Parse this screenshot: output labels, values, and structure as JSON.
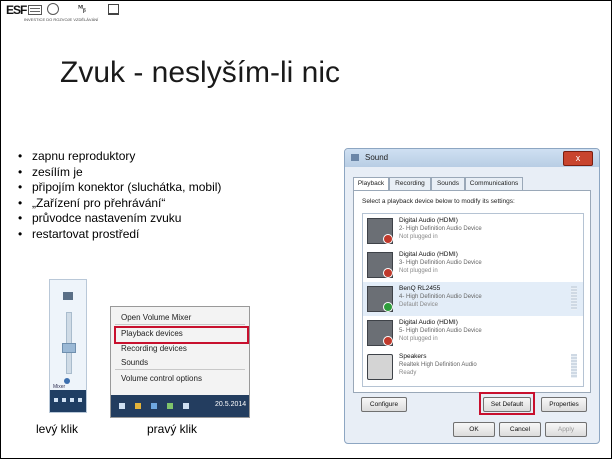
{
  "logos": {
    "esf": "ESF",
    "msmt": "ᴹᵦ",
    "tagline": "INVESTICE DO ROZVOJE VZDĚLÁVÁNÍ"
  },
  "title": "Zvuk - neslyším-li nic",
  "bullets": [
    "zapnu reproduktory",
    "zesílím je",
    "připojím konektor (sluchátka, mobil)",
    "„Zařízení pro přehrávání“",
    "průvodce nastavením zvuku",
    "restartovat prostředí"
  ],
  "left_click": {
    "caption": "levý klik",
    "mixer_label": "Mixer",
    "volume_level": 0.45
  },
  "context_menu": {
    "caption": "pravý klik",
    "items": [
      "Open Volume Mixer",
      "Playback devices",
      "Recording devices",
      "Sounds",
      "Volume control options"
    ],
    "highlighted": "Playback devices",
    "date": "20.5.2014"
  },
  "sound_dialog": {
    "title": "Sound",
    "close": "x",
    "tabs": [
      "Playback",
      "Recording",
      "Sounds",
      "Communications"
    ],
    "active_tab": "Playback",
    "instruction": "Select a playback device below to modify its settings:",
    "devices": [
      {
        "name": "Digital Audio (HDMI)",
        "desc": "2- High Definition Audio Device",
        "status": "Not plugged in",
        "state": "unplugged"
      },
      {
        "name": "Digital Audio (HDMI)",
        "desc": "3- High Definition Audio Device",
        "status": "Not plugged in",
        "state": "unplugged"
      },
      {
        "name": "BenQ RL2455",
        "desc": "4- High Definition Audio Device",
        "status": "Default Device",
        "state": "default"
      },
      {
        "name": "Digital Audio (HDMI)",
        "desc": "5- High Definition Audio Device",
        "status": "Not plugged in",
        "state": "unplugged"
      },
      {
        "name": "Speakers",
        "desc": "Realtek High Definition Audio",
        "status": "Ready",
        "state": "ready"
      }
    ],
    "buttons": {
      "configure": "Configure",
      "set_default": "Set Default",
      "properties": "Properties",
      "ok": "OK",
      "cancel": "Cancel",
      "apply": "Apply"
    }
  },
  "colors": {
    "highlight_red": "#c8102e",
    "taskbar": "#1f3e63",
    "default_badge": "#2e9d3b",
    "unplugged_badge": "#c0392b"
  }
}
